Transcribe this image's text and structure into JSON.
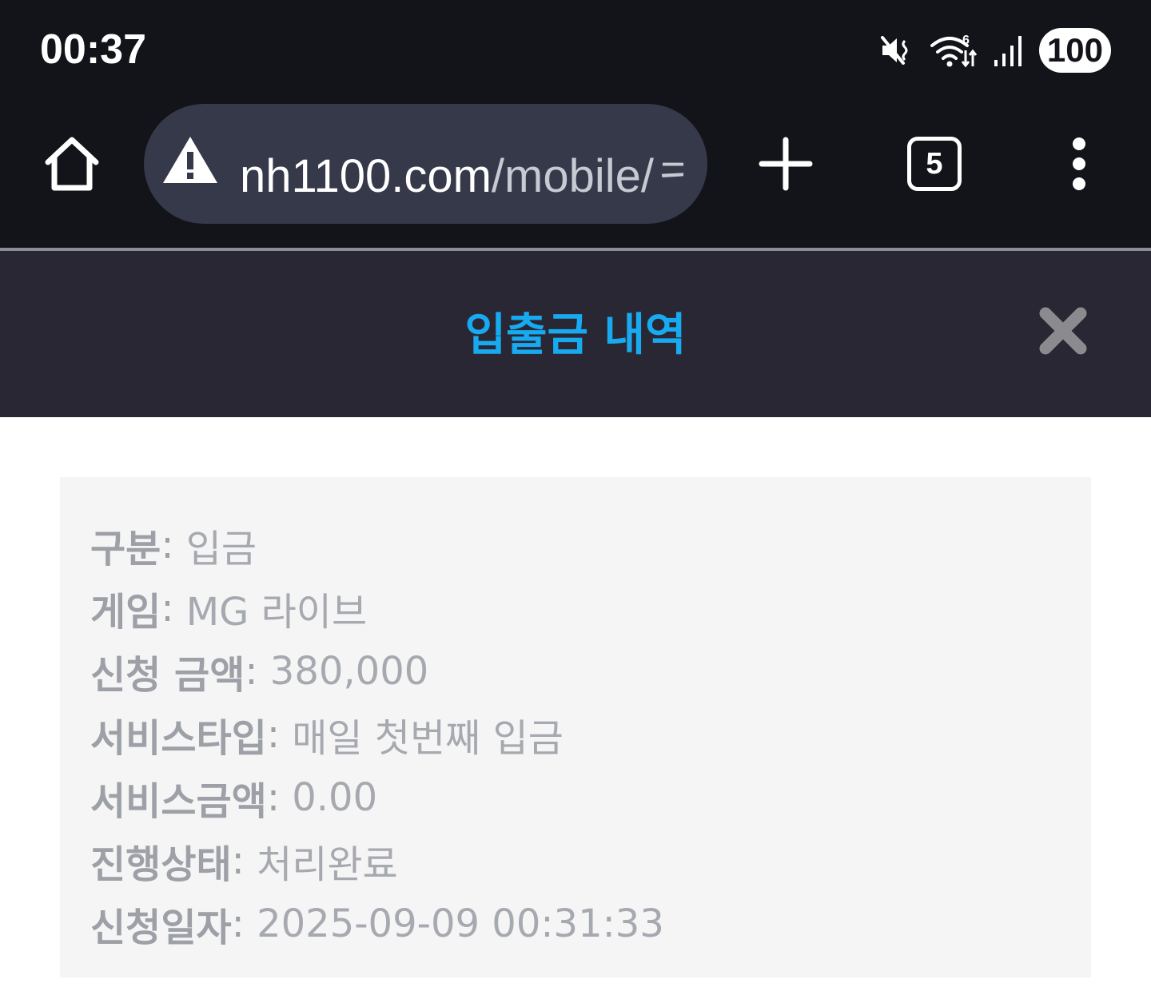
{
  "status_bar": {
    "time": "00:37",
    "battery": "100"
  },
  "browser": {
    "url_host": "nh1100.com",
    "url_path": "/mobile/ㅋ",
    "tab_count": "5"
  },
  "modal": {
    "title": "입출금 내역"
  },
  "details": [
    {
      "label": "구분",
      "value": "입금"
    },
    {
      "label": "게임",
      "value": "MG 라이브"
    },
    {
      "label": "신청 금액",
      "value": "380,000"
    },
    {
      "label": "서비스타입",
      "value": "매일 첫번째 입금"
    },
    {
      "label": "서비스금액",
      "value": "0.00"
    },
    {
      "label": "진행상태",
      "value": "처리완료"
    },
    {
      "label": "신청일자",
      "value": "2025-09-09 00:31:33"
    }
  ],
  "colors": {
    "title": "#18aaf0",
    "header_bg": "#292733",
    "browser_bg": "#131419",
    "detail_bg": "#f5f5f5",
    "detail_text": "#9ea0a7"
  }
}
